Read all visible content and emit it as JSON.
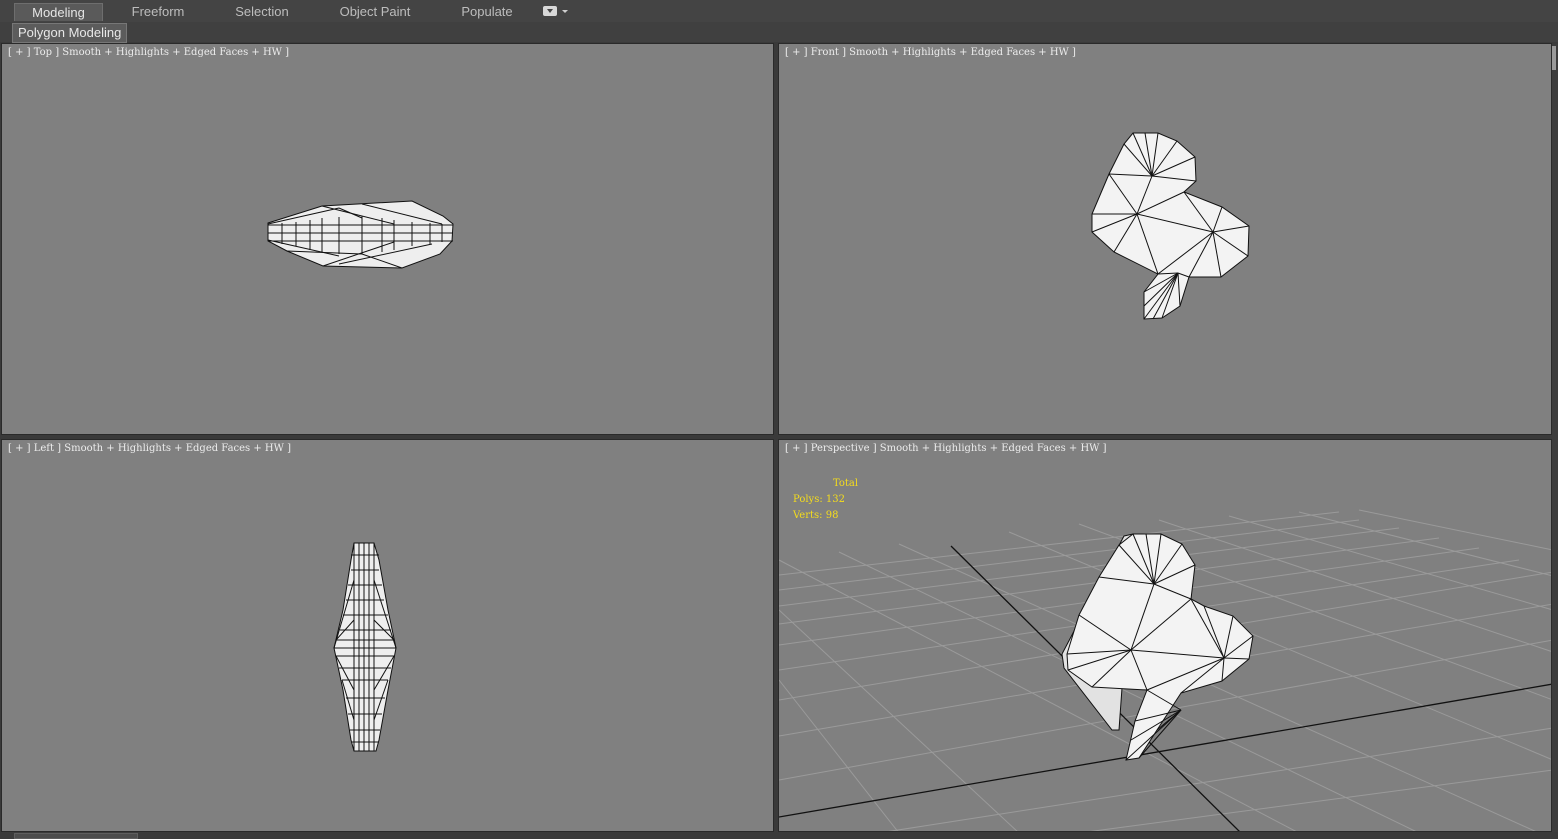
{
  "ribbon": {
    "tabs": [
      {
        "label": "Modeling",
        "active": true
      },
      {
        "label": "Freeform",
        "active": false
      },
      {
        "label": "Selection",
        "active": false
      },
      {
        "label": "Object Paint",
        "active": false
      },
      {
        "label": "Populate",
        "active": false
      }
    ],
    "options_icon": "dropdown-menu-icon",
    "panel_title": "Polygon Modeling"
  },
  "viewports": {
    "top": {
      "label": "[ + ] Top ] Smooth + Highlights + Edged Faces + HW ]"
    },
    "front": {
      "label": "[ + ] Front ] Smooth + Highlights + Edged Faces + HW ]"
    },
    "left": {
      "label": "[ + ] Left ] Smooth + Highlights + Edged Faces + HW ]"
    },
    "perspective": {
      "label": "[ + ] Perspective ] Smooth + Highlights + Edged Faces + HW ]"
    }
  },
  "stats": {
    "header": "Total",
    "polys_label": "Polys:",
    "polys_value": "132",
    "verts_label": "Verts:",
    "verts_value": "98"
  },
  "colors": {
    "viewport_bg": "#808080",
    "stats_text": "#f4dc1c",
    "mesh_fill": "#f2f2f2",
    "mesh_edge": "#111111"
  }
}
